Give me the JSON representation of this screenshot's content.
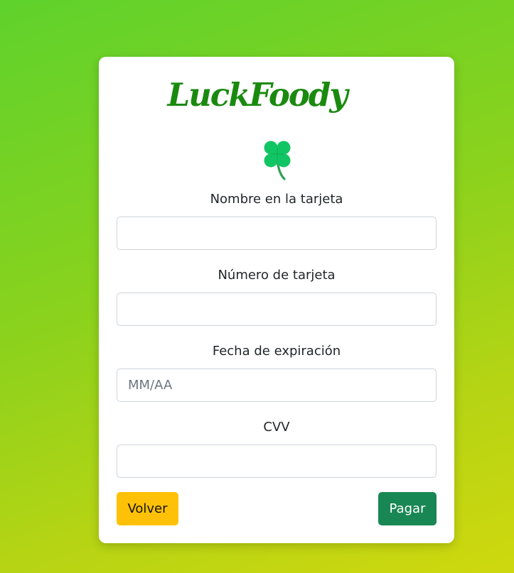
{
  "brand": {
    "name": "LuckFoody",
    "icon": "four-leaf-clover-icon",
    "color": "#1a8a0f"
  },
  "form": {
    "card_name": {
      "label": "Nombre en la tarjeta",
      "value": "",
      "placeholder": ""
    },
    "card_number": {
      "label": "Número de tarjeta",
      "value": "",
      "placeholder": ""
    },
    "expiry": {
      "label": "Fecha de expiración",
      "value": "",
      "placeholder": "MM/AA"
    },
    "cvv": {
      "label": "CVV",
      "value": "",
      "placeholder": ""
    }
  },
  "actions": {
    "back_label": "Volver",
    "back_color": "#ffc107",
    "pay_label": "Pagar",
    "pay_color": "#198754"
  }
}
